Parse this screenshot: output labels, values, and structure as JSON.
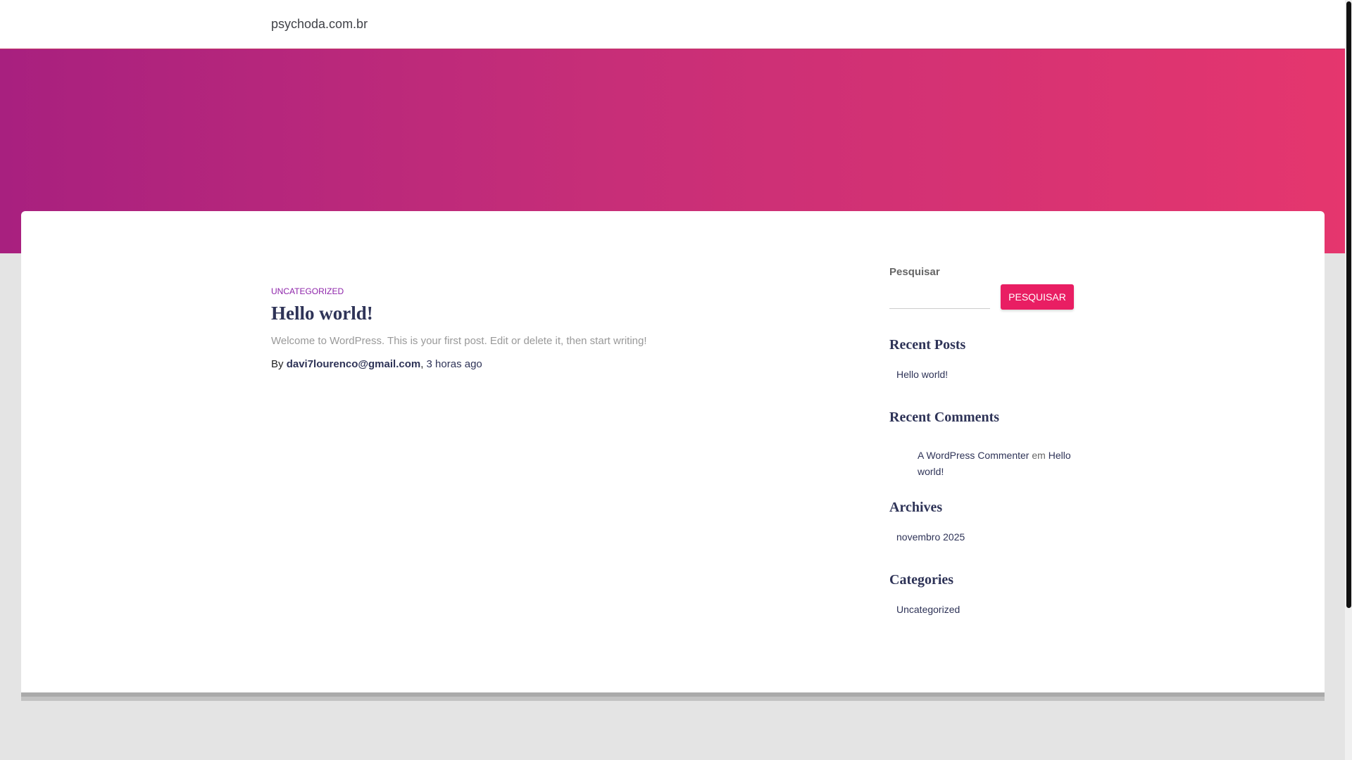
{
  "header": {
    "site_title": "psychoda.com.br"
  },
  "post": {
    "category": "UNCATEGORIZED",
    "title": "Hello world!",
    "excerpt": "Welcome to WordPress. This is your first post. Edit or delete it, then start writing!",
    "by": "By",
    "author": "davi7lourenco@gmail.com",
    "sep": ",",
    "time": "3 horas ago"
  },
  "sidebar": {
    "search": {
      "label": "Pesquisar",
      "value": "",
      "button": "PESQUISAR"
    },
    "recent_posts": {
      "title": "Recent Posts",
      "items": [
        "Hello world!"
      ]
    },
    "recent_comments": {
      "title": "Recent Comments",
      "author": "A WordPress Commenter",
      "em": "em",
      "post_line1": "Hello",
      "post_line2": "world!"
    },
    "archives": {
      "title": "Archives",
      "items": [
        "novembro 2025"
      ]
    },
    "categories": {
      "title": "Categories",
      "items": [
        "Uncategorized"
      ]
    }
  }
}
